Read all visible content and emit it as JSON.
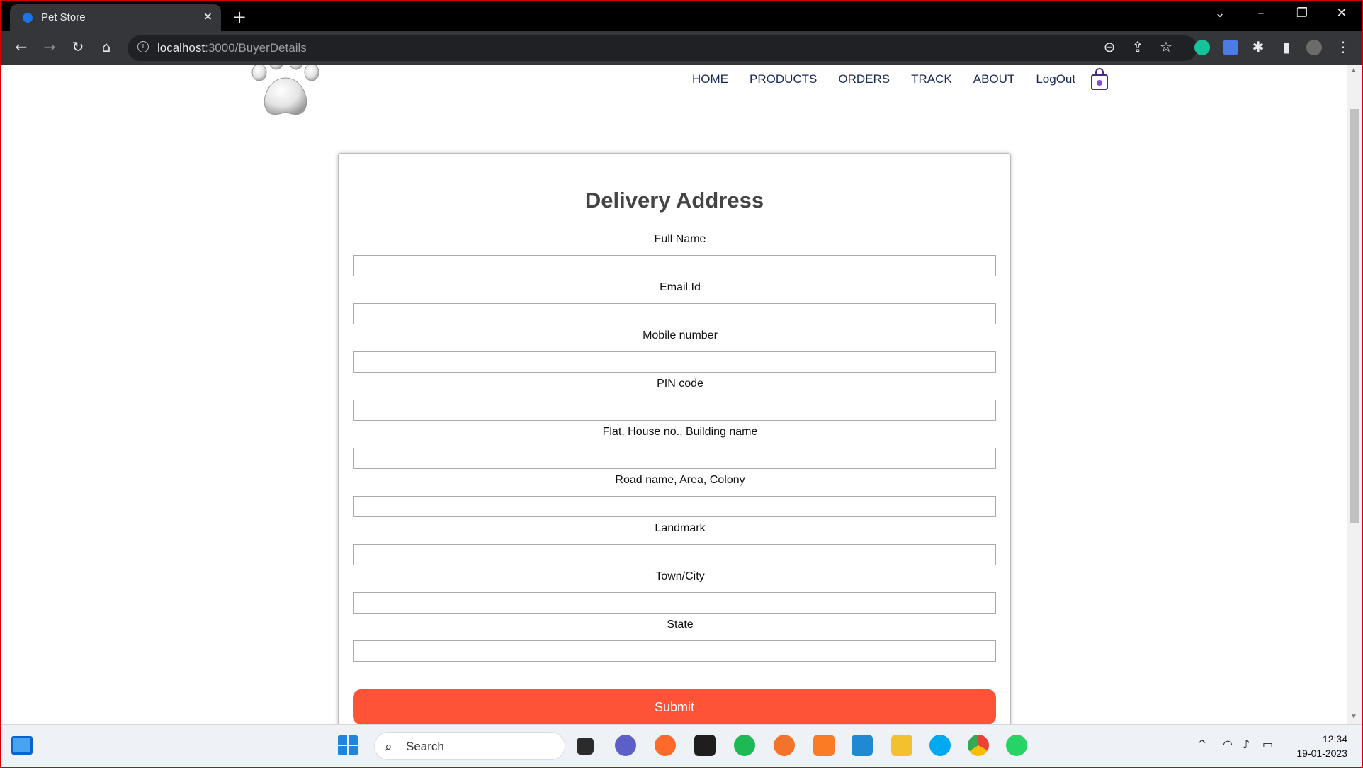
{
  "browser": {
    "tab_title": "Pet Store",
    "tab_close": "✕",
    "new_tab": "+",
    "url_host": "localhost",
    "url_path": ":3000/BuyerDetails",
    "window_controls": [
      "⌄",
      "–",
      "❐",
      "✕"
    ],
    "nav_icons": {
      "back": "←",
      "forward": "→",
      "reload": "↻",
      "home": "⌂"
    },
    "right_icons": {
      "zoom": "⊖",
      "share": "⇪",
      "bookmark": "☆",
      "extensions": "✱",
      "sidebar": "▮",
      "menu": "⋮"
    }
  },
  "site": {
    "nav": [
      "HOME",
      "PRODUCTS",
      "ORDERS",
      "TRACK",
      "ABOUT",
      "LogOut"
    ]
  },
  "form": {
    "title": "Delivery Address",
    "fields": [
      {
        "label": "Full Name",
        "value": ""
      },
      {
        "label": "Email Id",
        "value": ""
      },
      {
        "label": "Mobile number",
        "value": ""
      },
      {
        "label": "PIN code",
        "value": ""
      },
      {
        "label": "Flat, House no., Building name",
        "value": ""
      },
      {
        "label": "Road name, Area, Colony",
        "value": ""
      },
      {
        "label": "Landmark",
        "value": ""
      },
      {
        "label": "Town/City",
        "value": ""
      },
      {
        "label": "State",
        "value": ""
      }
    ],
    "submit_label": "Submit",
    "submit_color": "#ff5337"
  },
  "taskbar": {
    "search_label": "Search",
    "time": "12:34",
    "date": "19-01-2023",
    "tray": [
      "^",
      "◠",
      "♪",
      "▭"
    ]
  }
}
